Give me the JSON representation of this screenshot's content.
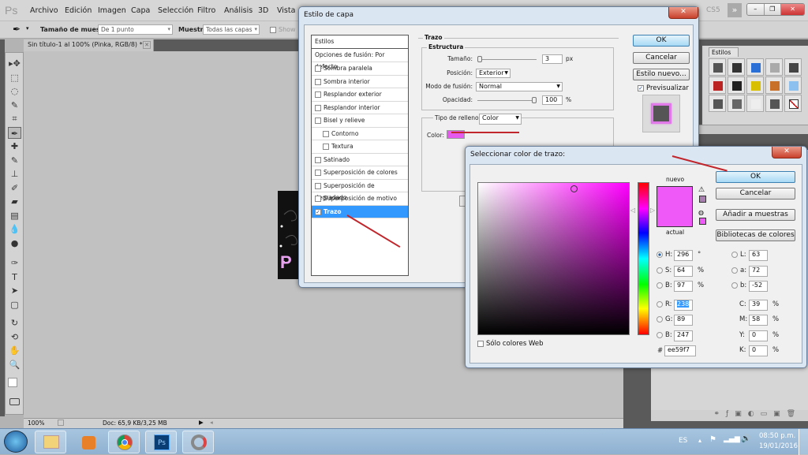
{
  "app": {
    "logo": "Ps",
    "menu": [
      "Archivo",
      "Edición",
      "Imagen",
      "Capa",
      "Selección",
      "Filtro",
      "Análisis",
      "3D",
      "Vista"
    ],
    "workspace_label": "CS5",
    "window_controls": {
      "minimize": "–",
      "restore": "❐",
      "close": "✕"
    }
  },
  "options_bar": {
    "tool_icon": "eyedropper-icon",
    "sample_size_label": "Tamaño de muestra:",
    "sample_size_value": "De 1 punto",
    "sample_label": "Muestra:",
    "sample_value": "Todas las capas",
    "show_label": "Show"
  },
  "document": {
    "tab_title": "Sin título-1 al 100% (Pinka, RGB/8) *",
    "close": "✕",
    "art_letter": "P"
  },
  "status_bar": {
    "zoom": "100%",
    "doc_info": "Doc: 65,9 KB/3,25 MB"
  },
  "tools": [
    "move",
    "marquee",
    "lasso",
    "quick-selection",
    "crop",
    "eyedropper",
    "healing",
    "brush",
    "clone-stamp",
    "history-brush",
    "eraser",
    "gradient",
    "blur",
    "dodge",
    "pen",
    "type",
    "path-selection",
    "shape",
    "3d-rotate",
    "3d-orbit",
    "hand",
    "zoom"
  ],
  "tool_glyphs": [
    "▸✥",
    "⬚",
    "◌",
    "✎",
    "⌗",
    "✒",
    "✚",
    "✎",
    "⊥",
    "✐",
    "▰",
    "▤",
    "💧",
    "●",
    "✑",
    "T",
    "➤",
    "▢",
    "↻",
    "⟲",
    "✋",
    "🔍"
  ],
  "styles_panel": {
    "tab": "Estilos",
    "swatches": [
      [
        "#555",
        "#333",
        "#2a6fd6",
        "#aaa",
        "#444"
      ],
      [
        "#b22",
        "#222",
        "#d8c000",
        "#c8702a",
        "#8cc0ee"
      ],
      [
        "#555",
        "#666",
        "#eee",
        "#555",
        "none"
      ]
    ]
  },
  "layer_style_dialog": {
    "title": "Estilo de capa",
    "list_header": "Estilos",
    "blend_options": "Opciones de fusión: Por defecto",
    "items": [
      {
        "label": "Sombra paralela",
        "checked": false,
        "indent": false
      },
      {
        "label": "Sombra interior",
        "checked": false,
        "indent": false
      },
      {
        "label": "Resplandor exterior",
        "checked": false,
        "indent": false
      },
      {
        "label": "Resplandor interior",
        "checked": false,
        "indent": false
      },
      {
        "label": "Bisel y relieve",
        "checked": false,
        "indent": false
      },
      {
        "label": "Contorno",
        "checked": false,
        "indent": true
      },
      {
        "label": "Textura",
        "checked": false,
        "indent": true
      },
      {
        "label": "Satinado",
        "checked": false,
        "indent": false
      },
      {
        "label": "Superposición de colores",
        "checked": false,
        "indent": false
      },
      {
        "label": "Superposición de degradado",
        "checked": false,
        "indent": false
      },
      {
        "label": "Superposición de motivo",
        "checked": false,
        "indent": false
      },
      {
        "label": "Trazo",
        "checked": true,
        "indent": false,
        "selected": true
      }
    ],
    "section_title": "Trazo",
    "structure_title": "Estructura",
    "size_label": "Tamaño:",
    "size_value": "3",
    "size_unit": "px",
    "position_label": "Posición:",
    "position_value": "Exterior",
    "blend_mode_label": "Modo de fusión:",
    "blend_mode_value": "Normal",
    "opacity_label": "Opacidad:",
    "opacity_value": "100",
    "opacity_unit": "%",
    "fill_type_label": "Tipo de relleno:",
    "fill_type_value": "Color",
    "color_label": "Color:",
    "color_swatch": "#e659ee",
    "ok": "OK",
    "cancel": "Cancelar",
    "new_style": "Estilo nuevo...",
    "preview_label": "Previsualizar",
    "preview_checked": true
  },
  "color_picker": {
    "title": "Seleccionar color de trazo:",
    "new_label": "nuevo",
    "current_label": "actual",
    "new_color": "#ee59f7",
    "current_color": "#ee59f7",
    "gamut_warning_color": "#a87fb0",
    "web_safe_color": "#ee59f7",
    "web_only_label": "Sólo colores Web",
    "web_only_checked": false,
    "ok": "OK",
    "cancel": "Cancelar",
    "add_swatch": "Añadir a muestras",
    "libraries": "Bibliotecas de colores",
    "hue_base": "#ff00ff",
    "fields_left": [
      {
        "label": "H:",
        "value": "296",
        "unit": "°",
        "radio": true,
        "on": true
      },
      {
        "label": "S:",
        "value": "64",
        "unit": "%",
        "radio": true,
        "on": false
      },
      {
        "label": "B:",
        "value": "97",
        "unit": "%",
        "radio": true,
        "on": false
      },
      {
        "label": "R:",
        "value": "238",
        "unit": "",
        "radio": true,
        "on": false,
        "highlight": true
      },
      {
        "label": "G:",
        "value": "89",
        "unit": "",
        "radio": true,
        "on": false
      },
      {
        "label": "B:",
        "value": "247",
        "unit": "",
        "radio": true,
        "on": false
      }
    ],
    "fields_right": [
      {
        "label": "L:",
        "value": "63",
        "unit": "",
        "radio": true
      },
      {
        "label": "a:",
        "value": "72",
        "unit": "",
        "radio": true
      },
      {
        "label": "b:",
        "value": "-52",
        "unit": "",
        "radio": true
      },
      {
        "label": "C:",
        "value": "39",
        "unit": "%",
        "radio": false
      },
      {
        "label": "M:",
        "value": "58",
        "unit": "%",
        "radio": false
      },
      {
        "label": "Y:",
        "value": "0",
        "unit": "%",
        "radio": false
      },
      {
        "label": "K:",
        "value": "0",
        "unit": "%",
        "radio": false
      }
    ],
    "hex_label": "#",
    "hex_value": "ee59f7"
  },
  "taskbar": {
    "apps": [
      "windows-explorer",
      "media-player",
      "chrome",
      "photoshop",
      "photoscape"
    ],
    "language": "ES",
    "time": "08:50 p.m.",
    "date": "19/01/2016"
  }
}
